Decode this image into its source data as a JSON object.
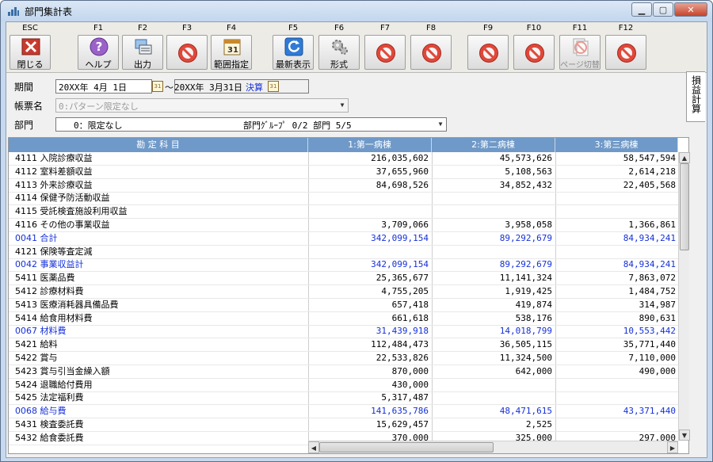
{
  "window": {
    "title": "部門集計表"
  },
  "toolbar": {
    "buttons": [
      {
        "key": "ESC",
        "label": "閉じる",
        "icon": "close-x-icon",
        "disabled": false
      },
      {
        "key": "F1",
        "label": "ヘルプ",
        "icon": "help-icon",
        "disabled": false
      },
      {
        "key": "F2",
        "label": "出力",
        "icon": "print-output-icon",
        "disabled": false
      },
      {
        "key": "F3",
        "label": "",
        "icon": "prohibited-icon",
        "disabled": true
      },
      {
        "key": "F4",
        "label": "範囲指定",
        "icon": "calendar-range-icon",
        "disabled": false
      },
      {
        "key": "F5",
        "label": "最新表示",
        "icon": "refresh-icon",
        "disabled": false
      },
      {
        "key": "F6",
        "label": "形式",
        "icon": "gear-icon",
        "disabled": false
      },
      {
        "key": "F7",
        "label": "",
        "icon": "prohibited-icon",
        "disabled": true
      },
      {
        "key": "F8",
        "label": "",
        "icon": "prohibited-icon",
        "disabled": true
      },
      {
        "key": "F9",
        "label": "",
        "icon": "prohibited-icon",
        "disabled": true
      },
      {
        "key": "F10",
        "label": "",
        "icon": "prohibited-icon",
        "disabled": true
      },
      {
        "key": "F11",
        "label": "ページ切替",
        "icon": "page-switch-icon",
        "disabled": true
      },
      {
        "key": "F12",
        "label": "",
        "icon": "prohibited-icon",
        "disabled": true
      }
    ]
  },
  "filters": {
    "period_label": "期間",
    "period_start": "20XX年 4月 1日",
    "period_sep": "～",
    "period_end": "20XX年 3月31日",
    "period_mode": "決算",
    "form_label": "帳票名",
    "form_value": "0:パターン限定なし",
    "dept_label": "部門",
    "dept_value": "0：限定なし",
    "dept_info": "部門ｸﾞﾙｰﾌﾟ 0/2  部門 5/5"
  },
  "side_tab": {
    "label": "損益計算"
  },
  "table": {
    "headers": [
      "勘 定 科 目",
      "1:第一病棟",
      "2:第二病棟",
      "3:第三病棟"
    ],
    "rows": [
      {
        "name": "4111 入院診療収益",
        "v1": "216,035,602",
        "v2": "45,573,626",
        "v3": "58,547,594",
        "total": false
      },
      {
        "name": "4112 室料差額収益",
        "v1": "37,655,960",
        "v2": "5,108,563",
        "v3": "2,614,218",
        "total": false
      },
      {
        "name": "4113 外来診療収益",
        "v1": "84,698,526",
        "v2": "34,852,432",
        "v3": "22,405,568",
        "total": false
      },
      {
        "name": "4114 保健予防活動収益",
        "v1": "",
        "v2": "",
        "v3": "",
        "total": false
      },
      {
        "name": "4115 受託検査施設利用収益",
        "v1": "",
        "v2": "",
        "v3": "",
        "total": false
      },
      {
        "name": "4116 その他の事業収益",
        "v1": "3,709,066",
        "v2": "3,958,058",
        "v3": "1,366,861",
        "total": false
      },
      {
        "name": "0041 合計",
        "v1": "342,099,154",
        "v2": "89,292,679",
        "v3": "84,934,241",
        "total": true
      },
      {
        "name": "4121 保険等査定減",
        "v1": "",
        "v2": "",
        "v3": "",
        "total": false
      },
      {
        "name": "0042 事業収益計",
        "v1": "342,099,154",
        "v2": "89,292,679",
        "v3": "84,934,241",
        "total": true
      },
      {
        "name": "5411 医薬品費",
        "v1": "25,365,677",
        "v2": "11,141,324",
        "v3": "7,863,072",
        "total": false
      },
      {
        "name": "5412 診療材料費",
        "v1": "4,755,205",
        "v2": "1,919,425",
        "v3": "1,484,752",
        "total": false
      },
      {
        "name": "5413 医療消耗器具備品費",
        "v1": "657,418",
        "v2": "419,874",
        "v3": "314,987",
        "total": false
      },
      {
        "name": "5414 給食用材料費",
        "v1": "661,618",
        "v2": "538,176",
        "v3": "890,631",
        "total": false
      },
      {
        "name": "0067 材料費",
        "v1": "31,439,918",
        "v2": "14,018,799",
        "v3": "10,553,442",
        "total": true
      },
      {
        "name": "5421 給料",
        "v1": "112,484,473",
        "v2": "36,505,115",
        "v3": "35,771,440",
        "total": false
      },
      {
        "name": "5422 賞与",
        "v1": "22,533,826",
        "v2": "11,324,500",
        "v3": "7,110,000",
        "total": false
      },
      {
        "name": "5423 賞与引当金繰入額",
        "v1": "870,000",
        "v2": "642,000",
        "v3": "490,000",
        "total": false
      },
      {
        "name": "5424 退職給付費用",
        "v1": "430,000",
        "v2": "",
        "v3": "",
        "total": false
      },
      {
        "name": "5425 法定福利費",
        "v1": "5,317,487",
        "v2": "",
        "v3": "",
        "total": false
      },
      {
        "name": "0068 給与費",
        "v1": "141,635,786",
        "v2": "48,471,615",
        "v3": "43,371,440",
        "total": true
      },
      {
        "name": "5431 検査委託費",
        "v1": "15,629,457",
        "v2": "2,525",
        "v3": "",
        "total": false
      },
      {
        "name": "5432 給食委託費",
        "v1": "370,000",
        "v2": "325,000",
        "v3": "297,000",
        "total": false
      }
    ]
  }
}
